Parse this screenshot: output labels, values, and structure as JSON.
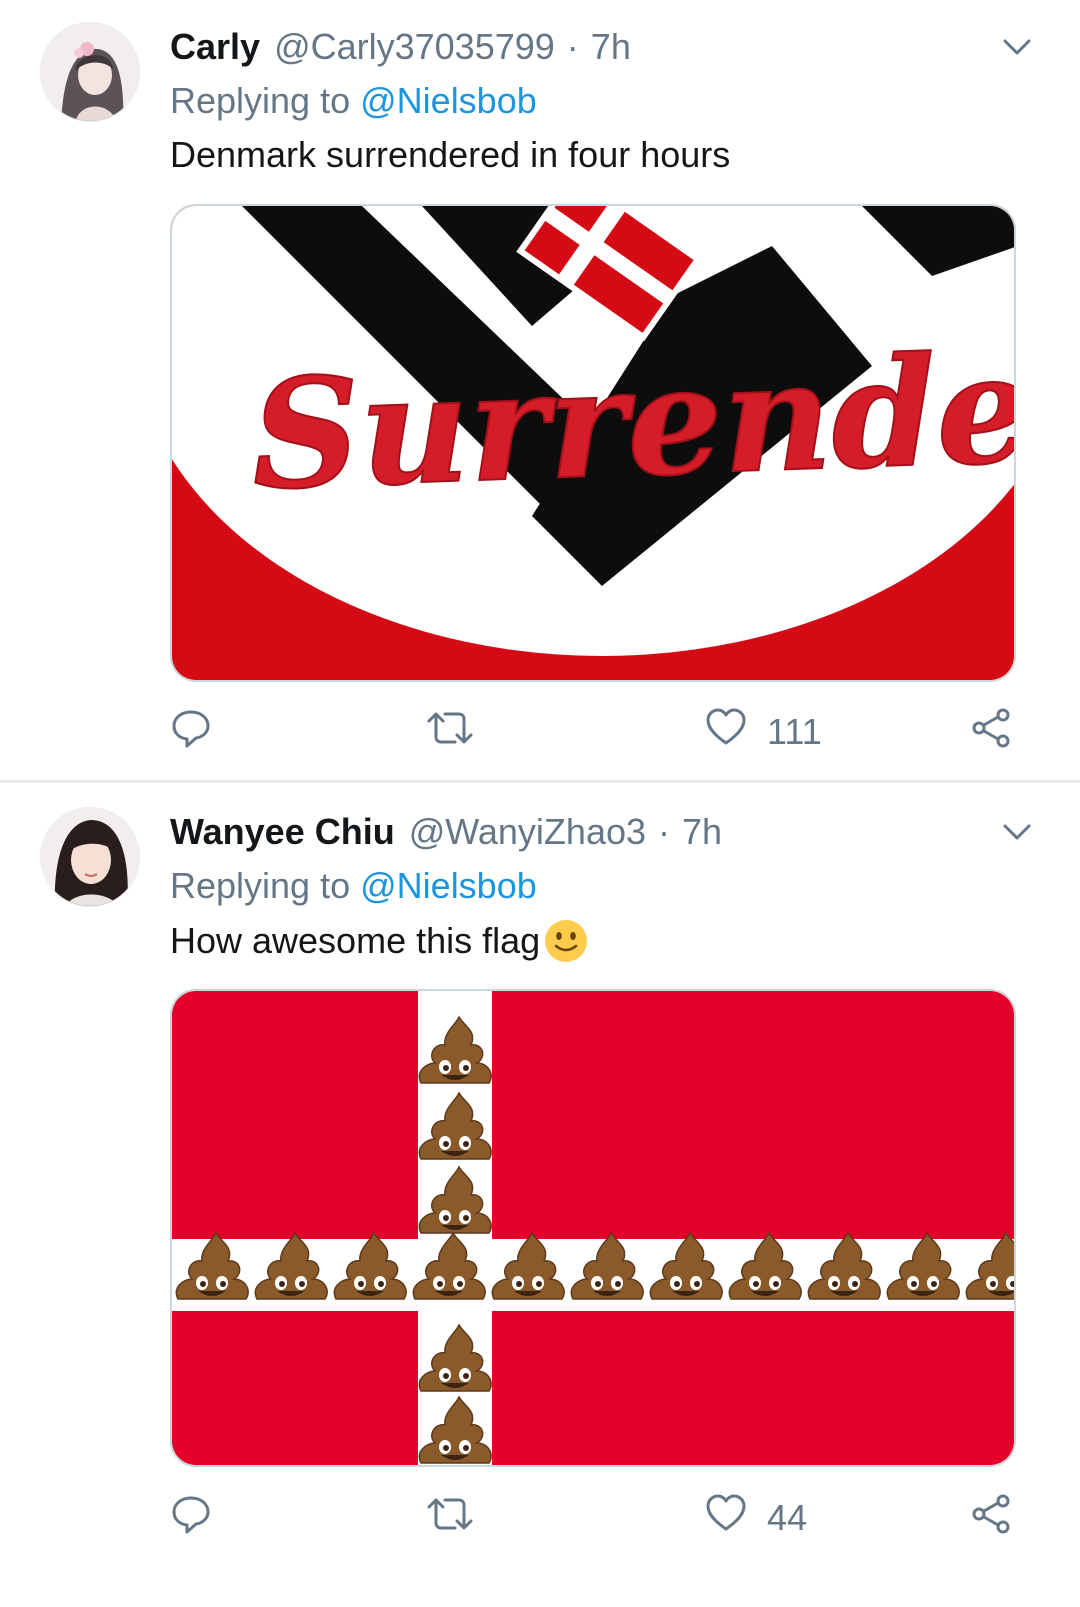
{
  "tweets": [
    {
      "name": "Carly",
      "handle": "@Carly37035799",
      "separator": "·",
      "time": "7h",
      "replying_prefix": "Replying to",
      "replying_to": "@Nielsbob",
      "text": "Denmark surrendered in four hours",
      "media_text": "Surrender",
      "likes": "111",
      "icons": [
        "reply-icon",
        "retweet-icon",
        "heart-icon",
        "share-icon",
        "chevron-down-icon"
      ]
    },
    {
      "name": "Wanyee Chiu",
      "handle": "@WanyiZhao3",
      "separator": "·",
      "time": "7h",
      "replying_prefix": "Replying to",
      "replying_to": "@Nielsbob",
      "text": "How awesome this flag",
      "emoji": "slightly-smiling-face",
      "likes": "44",
      "icons": [
        "reply-icon",
        "retweet-icon",
        "heart-icon",
        "share-icon",
        "chevron-down-icon"
      ]
    }
  ],
  "colors": {
    "text": "#14171a",
    "secondary": "#657786",
    "link": "#1b95e0",
    "divider": "#e6ecf0",
    "flag_red": "#e4002b"
  }
}
